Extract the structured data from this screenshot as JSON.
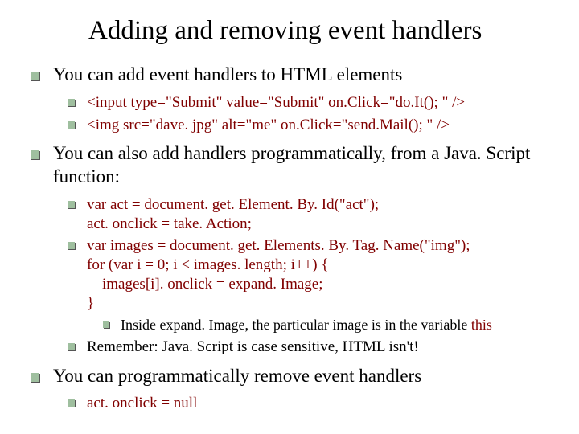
{
  "title": "Adding and removing event handlers",
  "b1": {
    "text": "You can add event handlers to HTML elements",
    "sub": [
      "<input type=\"Submit\" value=\"Submit\" on.Click=\"do.It(); \" />",
      "<img src=\"dave. jpg\" alt=\"me\" on.Click=\"send.Mail(); \" />"
    ]
  },
  "b2": {
    "text": "You can also add handlers programmatically, from a Java. Script function:",
    "code1": [
      "var act = document. get. Element. By. Id(\"act\");",
      "act. onclick = take. Action;"
    ],
    "code2": [
      "var images = document. get. Elements. By. Tag. Name(\"img\");",
      "for (var i = 0; i < images. length; i++) {",
      "    images[i]. onclick = expand. Image;",
      "}"
    ],
    "note_prefix": "Inside expand. Image, the particular image is in the variable ",
    "note_kw": "this",
    "remember": "Remember: Java. Script is case sensitive, HTML isn't!"
  },
  "b3": {
    "text": "You can programmatically remove event handlers",
    "code": "act. onclick = null"
  }
}
